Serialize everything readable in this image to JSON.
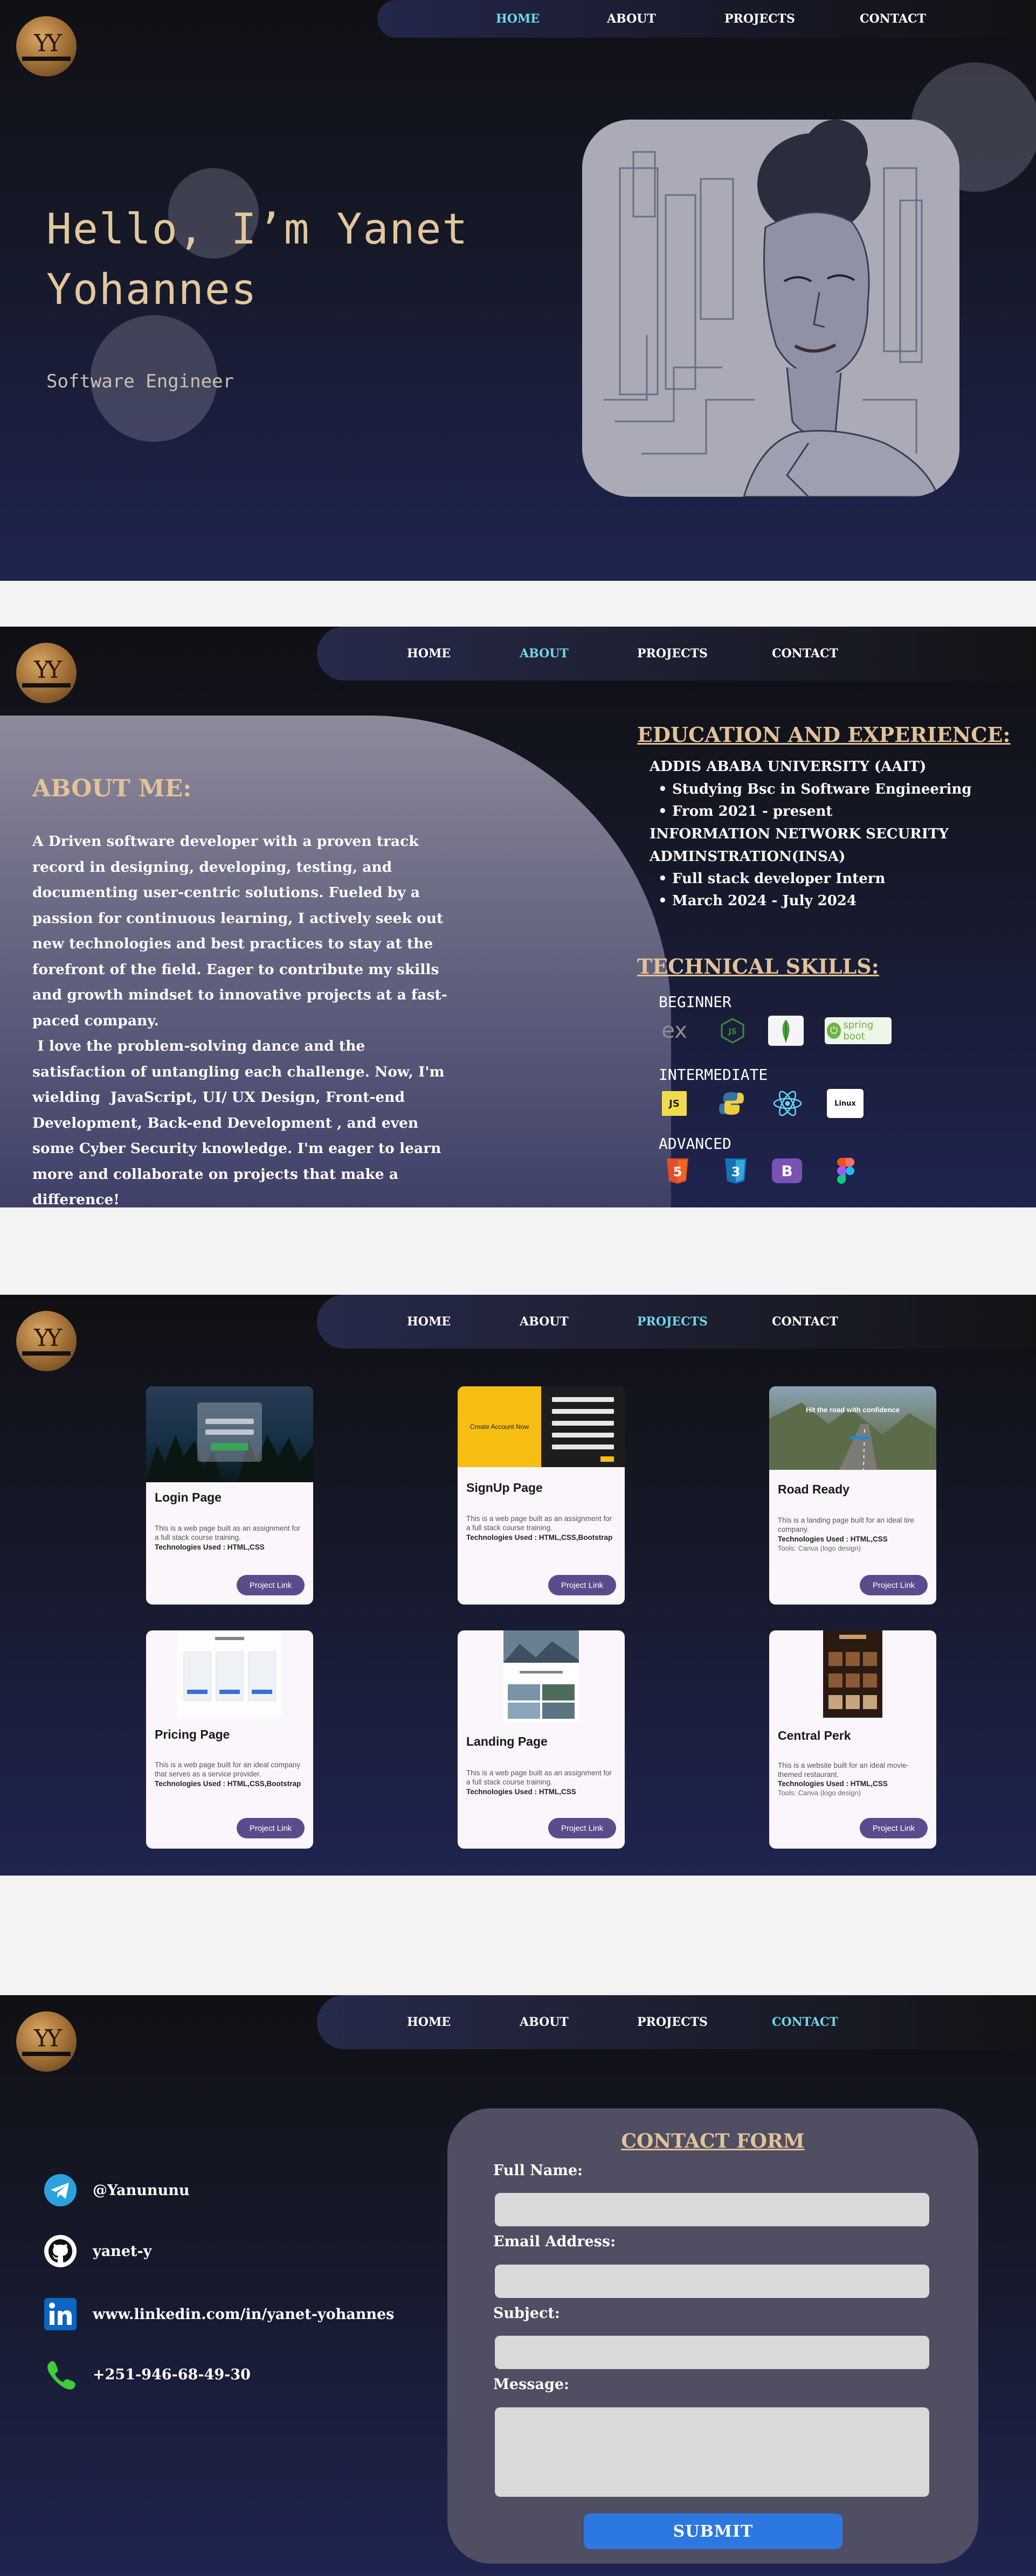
{
  "nav": {
    "home": "HOME",
    "about": "ABOUT",
    "projects": "PROJECTS",
    "contact": "CONTACT"
  },
  "logo": {
    "monogram": "YY"
  },
  "hero": {
    "greeting_line1": "Hello, I’m  Yanet",
    "greeting_line2": "Yohannes",
    "role": "Software Engineer"
  },
  "about": {
    "title": "ABOUT ME:",
    "text": "A Driven software developer with a proven track record in designing, developing, testing, and documenting user-centric solutions. Fueled by a passion for continuous learning, I actively seek out new technologies and best practices to stay at the forefront of the field. Eager to contribute my skills and growth mindset to innovative projects at a fast-paced company.\n I love the problem-solving dance and the satisfaction of untangling each challenge. Now, I'm wielding  JavaScript, UI/ UX Design, Front-end Development, Back-end Development , and even some Cyber Security knowledge. I'm eager to learn more and collaborate on projects that make a difference!",
    "education_title": "EDUCATION AND EXPERIENCE:",
    "org1": "ADDIS ABABA UNIVERSITY (AAIT)",
    "org1_items": [
      "Studying Bsc in Software Engineering",
      "From 2021 - present"
    ],
    "org2_line1": "INFORMATION NETWORK SECURITY",
    "org2_line2": "ADMINSTRATION(INSA)",
    "org2_items": [
      "Full stack developer Intern",
      "March 2024 - July 2024"
    ],
    "skills_title": "TECHNICAL SKILLS:",
    "levels": {
      "beginner": "BEGINNER",
      "intermediate": "INTERMEDIATE",
      "advanced": "ADVANCED"
    },
    "skill_icons": {
      "beginner": [
        "express-icon",
        "nodejs-icon",
        "mongodb-icon",
        "spring-boot-icon"
      ],
      "intermediate": [
        "javascript-icon",
        "python-icon",
        "react-icon",
        "linux-icon"
      ],
      "advanced": [
        "html5-icon",
        "css3-icon",
        "bootstrap-icon",
        "figma-icon"
      ]
    },
    "skill_badge_text": {
      "js": "JS",
      "spring": "spring boot",
      "linux": "Linux",
      "ex": "ex",
      "html": "5",
      "css": "3",
      "bootstrap": "B"
    }
  },
  "projects": [
    {
      "title": "Login Page",
      "desc": "This is a web page built  as an assignment for a full stack course training.",
      "tech": "Technologies Used : HTML,CSS",
      "tools": "",
      "button": "Project Link"
    },
    {
      "title": "SignUp Page",
      "desc": "This is a web page built  as an assignment for a full stack course training.",
      "tech": "Technologies Used : HTML,CSS,Bootstrap",
      "tools": "",
      "button": "Project Link",
      "thumb_text": "Create Account Now"
    },
    {
      "title": "Road Ready",
      "desc": "This is a  landing page built for an ideal tire company.",
      "tech": "Technologies Used : HTML,CSS",
      "tools": "Tools: Canva (logo design)",
      "button": "Project Link",
      "thumb_text": "Hit the road with confidence"
    },
    {
      "title": "Pricing Page",
      "desc": "This is a web page built for an ideal company that serves as a service provider.",
      "tech": "Technologies Used : HTML,CSS,Bootstrap",
      "tools": "",
      "button": "Project Link"
    },
    {
      "title": "Landing Page",
      "desc": "This is a web page built  as an assignment for a full stack course training.",
      "tech": "Technologies Used : HTML,CSS",
      "tools": "",
      "button": "Project Link"
    },
    {
      "title": "Central Perk",
      "desc": "This is a website built for an ideal movie-themed restaurant.",
      "tech": "Technologies Used : HTML,CSS",
      "tools": "Tools: Canva (logo design)",
      "button": "Project Link"
    }
  ],
  "contact": {
    "telegram": "@Yanununu",
    "github": "yanet-y",
    "linkedin": "www.linkedin.com/in/yanet-yohannes",
    "phone": "+251-946-68-49-30",
    "form_title": "CONTACT FORM",
    "full_name_label": "Full Name:",
    "email_label": "Email Address:",
    "subject_label": "Subject:",
    "message_label": "Message:",
    "submit": "SUBMIT"
  },
  "colors": {
    "accent_gold": "#e2c298",
    "nav_active": "#6fd7e8",
    "button_purple": "#5a4c8c",
    "submit_blue": "#2d78e0",
    "telegram_blue": "#2aa3dd",
    "linkedin_blue": "#0a66c2",
    "phone_green": "#3ecb3e"
  }
}
